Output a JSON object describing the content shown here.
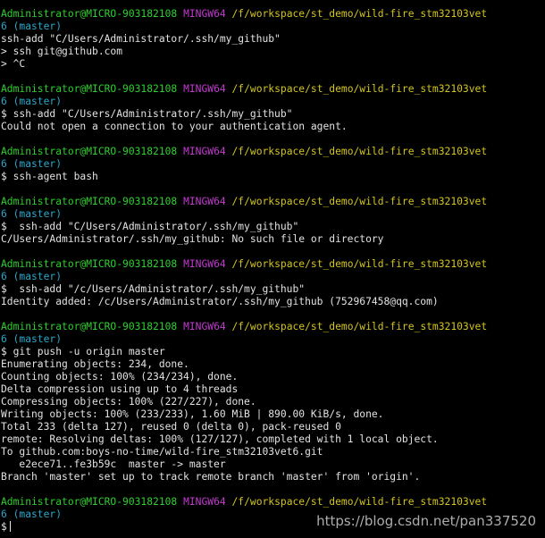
{
  "terminal": {
    "lines": [
      {
        "kind": "header",
        "user": "Administrator@MICRO-903182108",
        "env": "MINGW64",
        "path": "/f/workspace/st_demo/wild-fire_stm32103vet"
      },
      {
        "kind": "branch",
        "text": "6 (master)"
      },
      {
        "kind": "output",
        "text": "ssh-add \"C/Users/Administrator/.ssh/my_github\""
      },
      {
        "kind": "output",
        "text": "> ssh git@github.com"
      },
      {
        "kind": "output",
        "text": "> ^C"
      },
      {
        "kind": "blank"
      },
      {
        "kind": "header",
        "user": "Administrator@MICRO-903182108",
        "env": "MINGW64",
        "path": "/f/workspace/st_demo/wild-fire_stm32103vet"
      },
      {
        "kind": "branch",
        "text": "6 (master)"
      },
      {
        "kind": "output",
        "text": "$ ssh-add \"C/Users/Administrator/.ssh/my_github\""
      },
      {
        "kind": "output",
        "text": "Could not open a connection to your authentication agent."
      },
      {
        "kind": "blank"
      },
      {
        "kind": "header",
        "user": "Administrator@MICRO-903182108",
        "env": "MINGW64",
        "path": "/f/workspace/st_demo/wild-fire_stm32103vet"
      },
      {
        "kind": "branch",
        "text": "6 (master)"
      },
      {
        "kind": "output",
        "text": "$ ssh-agent bash"
      },
      {
        "kind": "blank"
      },
      {
        "kind": "header",
        "user": "Administrator@MICRO-903182108",
        "env": "MINGW64",
        "path": "/f/workspace/st_demo/wild-fire_stm32103vet"
      },
      {
        "kind": "branch",
        "text": "6 (master)"
      },
      {
        "kind": "output",
        "text": "$  ssh-add \"C/Users/Administrator/.ssh/my_github\""
      },
      {
        "kind": "output",
        "text": "C/Users/Administrator/.ssh/my_github: No such file or directory"
      },
      {
        "kind": "blank"
      },
      {
        "kind": "header",
        "user": "Administrator@MICRO-903182108",
        "env": "MINGW64",
        "path": "/f/workspace/st_demo/wild-fire_stm32103vet"
      },
      {
        "kind": "branch",
        "text": "6 (master)"
      },
      {
        "kind": "output",
        "text": "$  ssh-add \"/c/Users/Administrator/.ssh/my_github\""
      },
      {
        "kind": "output",
        "text": "Identity added: /c/Users/Administrator/.ssh/my_github (752967458@qq.com)"
      },
      {
        "kind": "blank"
      },
      {
        "kind": "header",
        "user": "Administrator@MICRO-903182108",
        "env": "MINGW64",
        "path": "/f/workspace/st_demo/wild-fire_stm32103vet"
      },
      {
        "kind": "branch",
        "text": "6 (master)"
      },
      {
        "kind": "output",
        "text": "$ git push -u origin master"
      },
      {
        "kind": "output",
        "text": "Enumerating objects: 234, done."
      },
      {
        "kind": "output",
        "text": "Counting objects: 100% (234/234), done."
      },
      {
        "kind": "output",
        "text": "Delta compression using up to 4 threads"
      },
      {
        "kind": "output",
        "text": "Compressing objects: 100% (227/227), done."
      },
      {
        "kind": "output",
        "text": "Writing objects: 100% (233/233), 1.60 MiB | 890.00 KiB/s, done."
      },
      {
        "kind": "output",
        "text": "Total 233 (delta 127), reused 0 (delta 0), pack-reused 0"
      },
      {
        "kind": "output",
        "text": "remote: Resolving deltas: 100% (127/127), completed with 1 local object."
      },
      {
        "kind": "output",
        "text": "To github.com:boys-no-time/wild-fire_stm32103vet6.git"
      },
      {
        "kind": "output",
        "text": "   e2ece71..fe3b59c  master -> master"
      },
      {
        "kind": "output",
        "text": "Branch 'master' set up to track remote branch 'master' from 'origin'."
      },
      {
        "kind": "blank"
      },
      {
        "kind": "header",
        "user": "Administrator@MICRO-903182108",
        "env": "MINGW64",
        "path": "/f/workspace/st_demo/wild-fire_stm32103vet"
      },
      {
        "kind": "branch",
        "text": "6 (master)"
      },
      {
        "kind": "prompt",
        "text": "$"
      }
    ]
  },
  "watermark": "https://blog.csdn.net/pan337520",
  "colors": {
    "background": "#000000",
    "text": "#e2e2e2",
    "user": "#2ecf2e",
    "env": "#c23ad0",
    "path": "#d3c41f",
    "branch": "#2aa7c9"
  }
}
